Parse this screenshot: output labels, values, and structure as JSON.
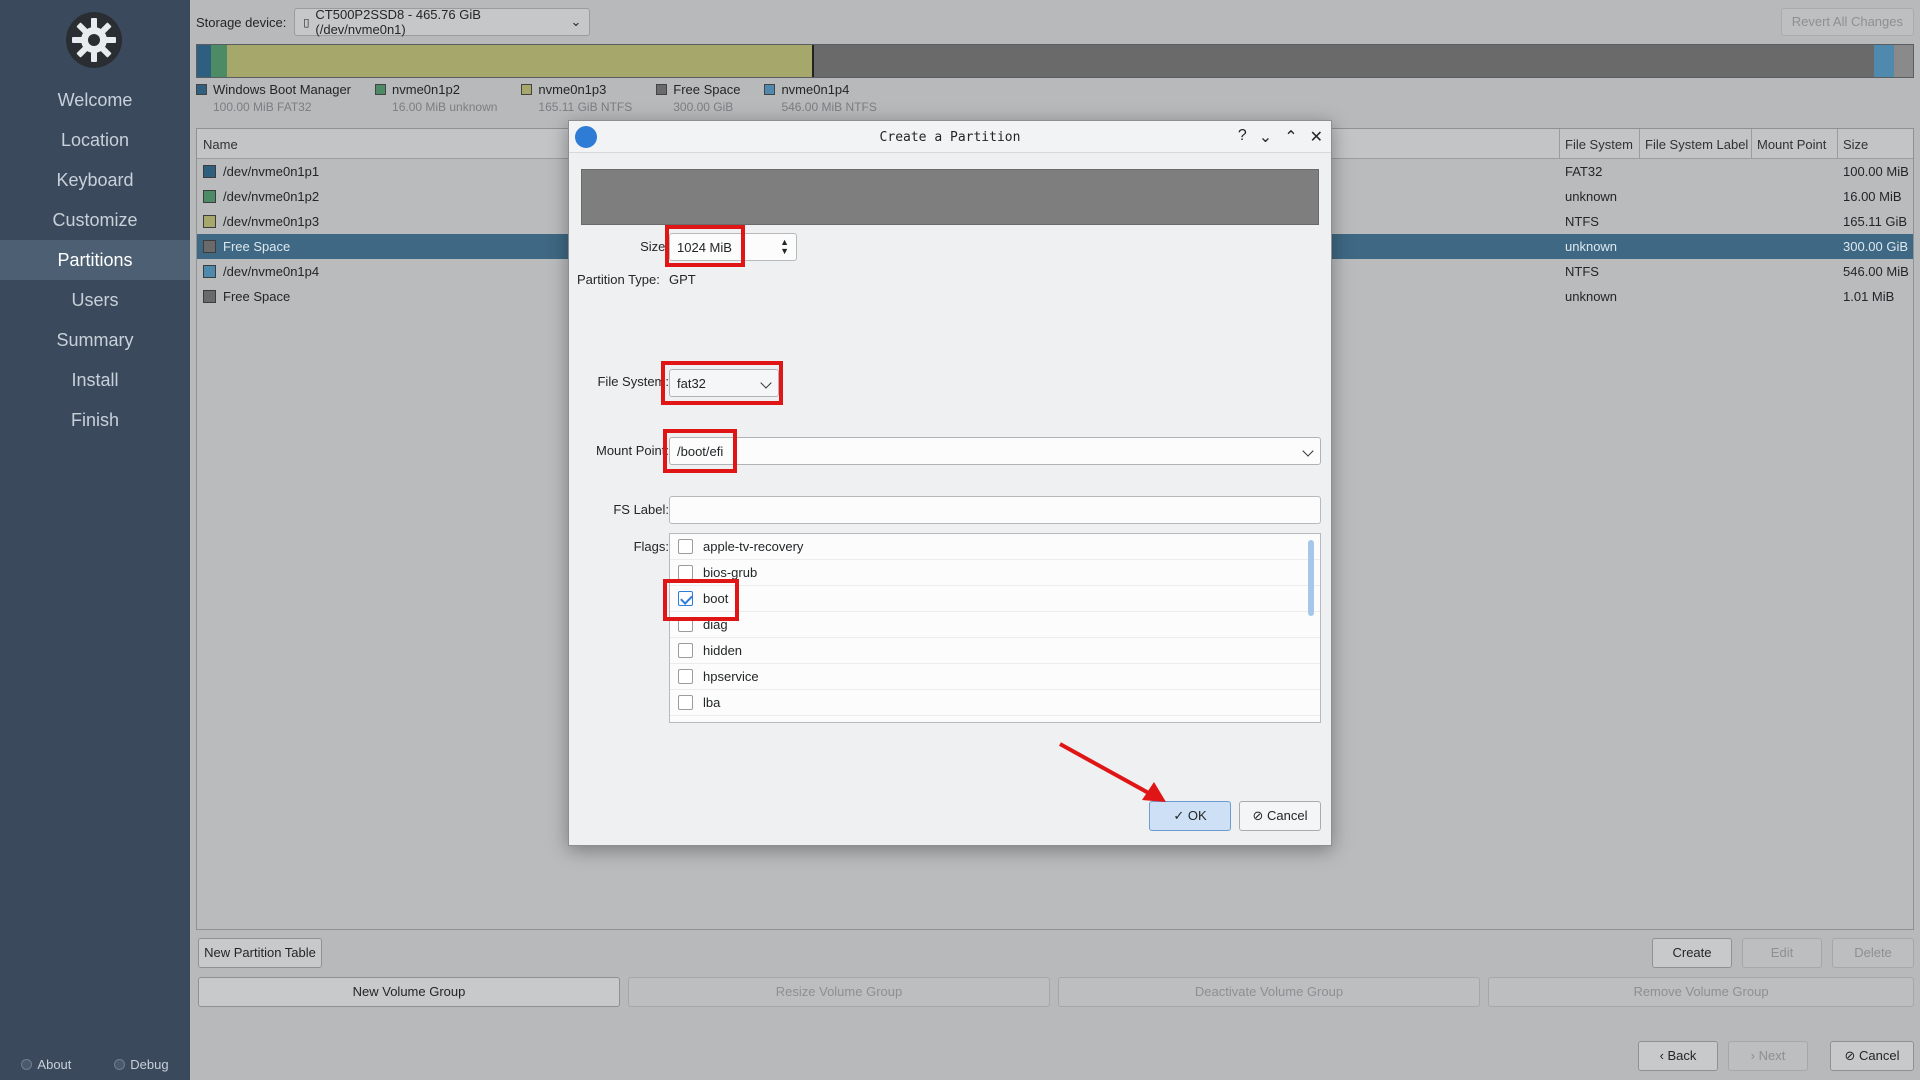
{
  "sidebar": {
    "items": [
      {
        "label": "Welcome"
      },
      {
        "label": "Location"
      },
      {
        "label": "Keyboard"
      },
      {
        "label": "Customize"
      },
      {
        "label": "Partitions"
      },
      {
        "label": "Users"
      },
      {
        "label": "Summary"
      },
      {
        "label": "Install"
      },
      {
        "label": "Finish"
      }
    ],
    "active": "Partitions",
    "about_label": "About",
    "debug_label": "Debug"
  },
  "storage": {
    "label": "Storage device:",
    "device": "CT500P2SSD8 - 465.76 GiB (/dev/nvme0n1)",
    "revert_label": "Revert All Changes"
  },
  "legend": [
    {
      "name": "Windows Boot Manager",
      "detail": "100.00 MiB  FAT32",
      "color": "#2e5f7f"
    },
    {
      "name": "nvme0n1p2",
      "detail": "16.00 MiB  unknown",
      "color": "#4d8a66"
    },
    {
      "name": "nvme0n1p3",
      "detail": "165.11 GiB  NTFS",
      "color": "#a5a86a"
    },
    {
      "name": "Free Space",
      "detail": "300.00 GiB",
      "color": "#6a6a6a"
    },
    {
      "name": "nvme0n1p4",
      "detail": "546.00 MiB  NTFS",
      "color": "#4f89ad"
    }
  ],
  "table": {
    "headers": [
      "Name",
      "File System",
      "File System Label",
      "Mount Point",
      "Size"
    ],
    "rows": [
      {
        "name": "/dev/nvme0n1p1",
        "fs": "FAT32",
        "size": "100.00 MiB",
        "color": "#2e5f7f",
        "selected": false
      },
      {
        "name": "/dev/nvme0n1p2",
        "fs": "unknown",
        "size": "16.00 MiB",
        "color": "#4d8a66",
        "selected": false
      },
      {
        "name": "/dev/nvme0n1p3",
        "fs": "NTFS",
        "size": "165.11 GiB",
        "color": "#a5a86a",
        "selected": false
      },
      {
        "name": "Free Space",
        "fs": "unknown",
        "size": "300.00 GiB",
        "color": "#6a6a6a",
        "selected": true
      },
      {
        "name": "/dev/nvme0n1p4",
        "fs": "NTFS",
        "size": "546.00 MiB",
        "color": "#4f89ad",
        "selected": false
      },
      {
        "name": "Free Space",
        "fs": "unknown",
        "size": "1.01 MiB",
        "color": "#6a6a6a",
        "selected": false
      }
    ]
  },
  "buttons": {
    "new_partition_table": "New Partition Table",
    "create": "Create",
    "edit": "Edit",
    "delete": "Delete",
    "new_volume_group": "New Volume Group",
    "resize_volume_group": "Resize Volume Group",
    "deactivate_volume_group": "Deactivate Volume Group",
    "remove_volume_group": "Remove Volume Group",
    "back": "Back",
    "next": "Next",
    "cancel": "Cancel"
  },
  "dialog": {
    "title": "Create a Partition",
    "size_label": "Size:",
    "size_value": "1024 MiB",
    "partition_type_label": "Partition Type:",
    "partition_type_value": "GPT",
    "fs_label": "File System:",
    "fs_value": "fat32",
    "mount_label": "Mount Point:",
    "mount_value": "/boot/efi",
    "fslabel_label": "FS Label:",
    "fslabel_value": "",
    "flags_label": "Flags:",
    "flags": [
      {
        "name": "apple-tv-recovery",
        "checked": false
      },
      {
        "name": "bios-grub",
        "checked": false
      },
      {
        "name": "boot",
        "checked": true
      },
      {
        "name": "diag",
        "checked": false
      },
      {
        "name": "hidden",
        "checked": false
      },
      {
        "name": "hpservice",
        "checked": false
      },
      {
        "name": "lba",
        "checked": false
      }
    ],
    "ok_label": "OK",
    "cancel_label": "Cancel"
  },
  "colors": {
    "sidebar_bg": "#3a4a5c",
    "selection": "#3e6883",
    "accent": "#2f7cd7",
    "annotation_red": "#e01515"
  }
}
